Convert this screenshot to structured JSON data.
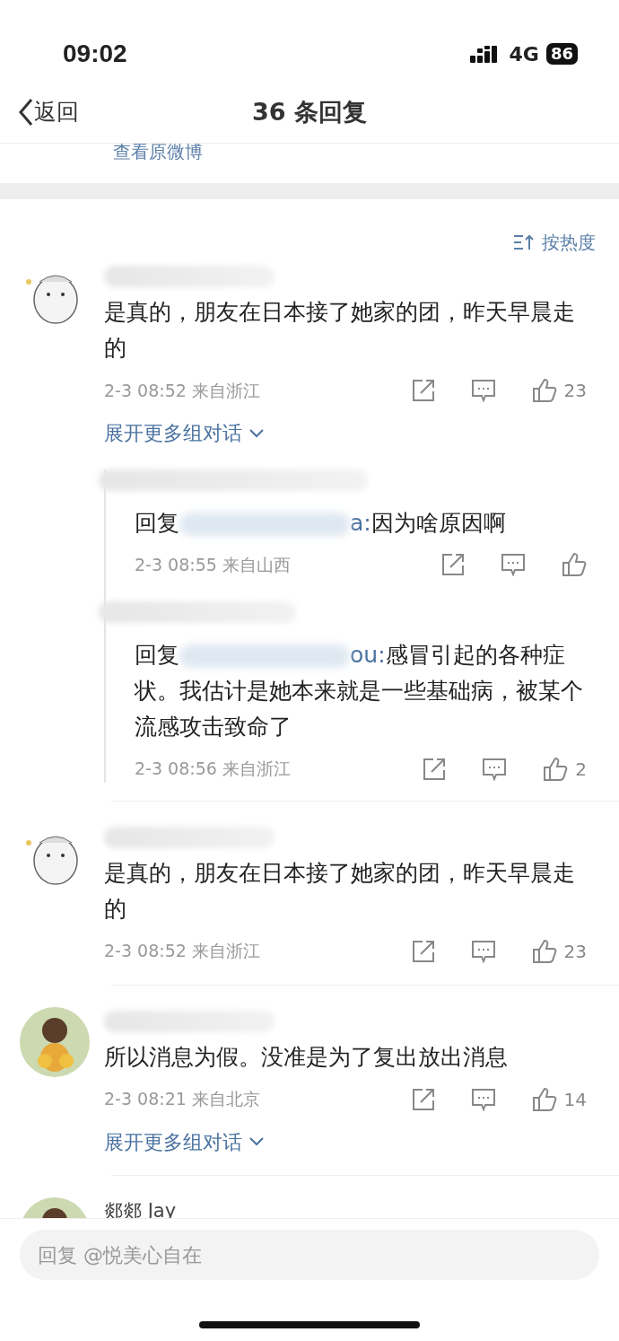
{
  "status_bar": {
    "time": "09:02",
    "network": "4G",
    "battery": "86"
  },
  "header": {
    "back": "返回",
    "title": "36 条回复"
  },
  "original_link": "查看原微博",
  "sort": {
    "label": "按热度"
  },
  "comments": [
    {
      "avatar": {
        "kind": "drawing"
      },
      "text": "是真的，朋友在日本接了她家的团，昨天早晨走的",
      "date": "2-3 08:52",
      "location": "来自浙江",
      "likes": "23",
      "expand": "展开更多组对话",
      "replies": [
        {
          "prefix": "回复",
          "mention_tail": "a:",
          "text": "因为啥原因啊",
          "date": "2-3 08:55",
          "location": "来自山西"
        },
        {
          "prefix": "回复",
          "mention_tail": "ou:",
          "text": "感冒引起的各种症状。我估计是她本来就是一些基础病，被某个流感攻击致命了",
          "date": "2-3 08:56",
          "location": "来自浙江",
          "likes": "2"
        }
      ]
    },
    {
      "avatar": {
        "kind": "drawing"
      },
      "text": "是真的，朋友在日本接了她家的团，昨天早晨走的",
      "date": "2-3 08:52",
      "location": "来自浙江",
      "likes": "23"
    },
    {
      "text": "所以消息为假。没准是为了复出放出消息",
      "date": "2-3 08:21",
      "location": "来自北京",
      "likes": "14",
      "expand": "展开更多组对话"
    },
    {
      "name": "郯郯 Jay"
    }
  ],
  "reply_input": {
    "placeholder": "回复 @悦美心自在"
  }
}
